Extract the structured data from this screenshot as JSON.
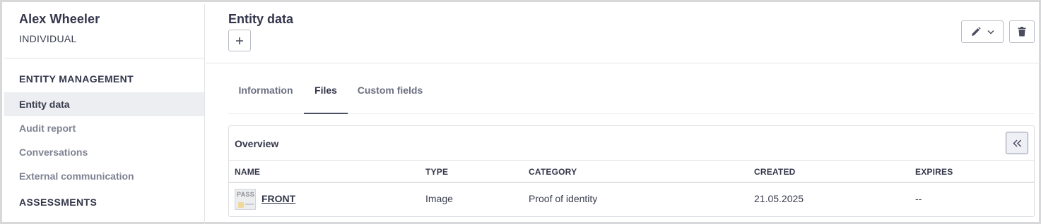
{
  "entity": {
    "name": "Alex Wheeler",
    "type": "INDIVIDUAL"
  },
  "sidebar": {
    "sections": [
      {
        "title": "ENTITY MANAGEMENT"
      },
      {
        "title": "ASSESSMENTS"
      }
    ],
    "items": [
      {
        "label": "Entity data",
        "active": true
      },
      {
        "label": "Audit report",
        "active": false
      },
      {
        "label": "Conversations",
        "active": false
      },
      {
        "label": "External communication",
        "active": false
      }
    ]
  },
  "header": {
    "title": "Entity data",
    "add_icon": "plus-icon",
    "edit_icon": "pencil-icon",
    "dropdown_icon": "chevron-down-icon",
    "delete_icon": "trash-icon"
  },
  "tabs": [
    {
      "label": "Information",
      "active": false
    },
    {
      "label": "Files",
      "active": true
    },
    {
      "label": "Custom fields",
      "active": false
    }
  ],
  "overview": {
    "title": "Overview",
    "collapse_icon": "double-chevron-left-icon",
    "columns": [
      "NAME",
      "TYPE",
      "CATEGORY",
      "CREATED",
      "EXPIRES"
    ],
    "rows": [
      {
        "thumbnail_label": "PASS",
        "name": "FRONT",
        "type": "Image",
        "category": "Proof of identity",
        "created": "21.05.2025",
        "expires": "--"
      }
    ]
  },
  "colors": {
    "accent": "#33364a",
    "muted": "#7f8293",
    "active_bg": "#eceef1",
    "border": "#b9bcc5"
  }
}
